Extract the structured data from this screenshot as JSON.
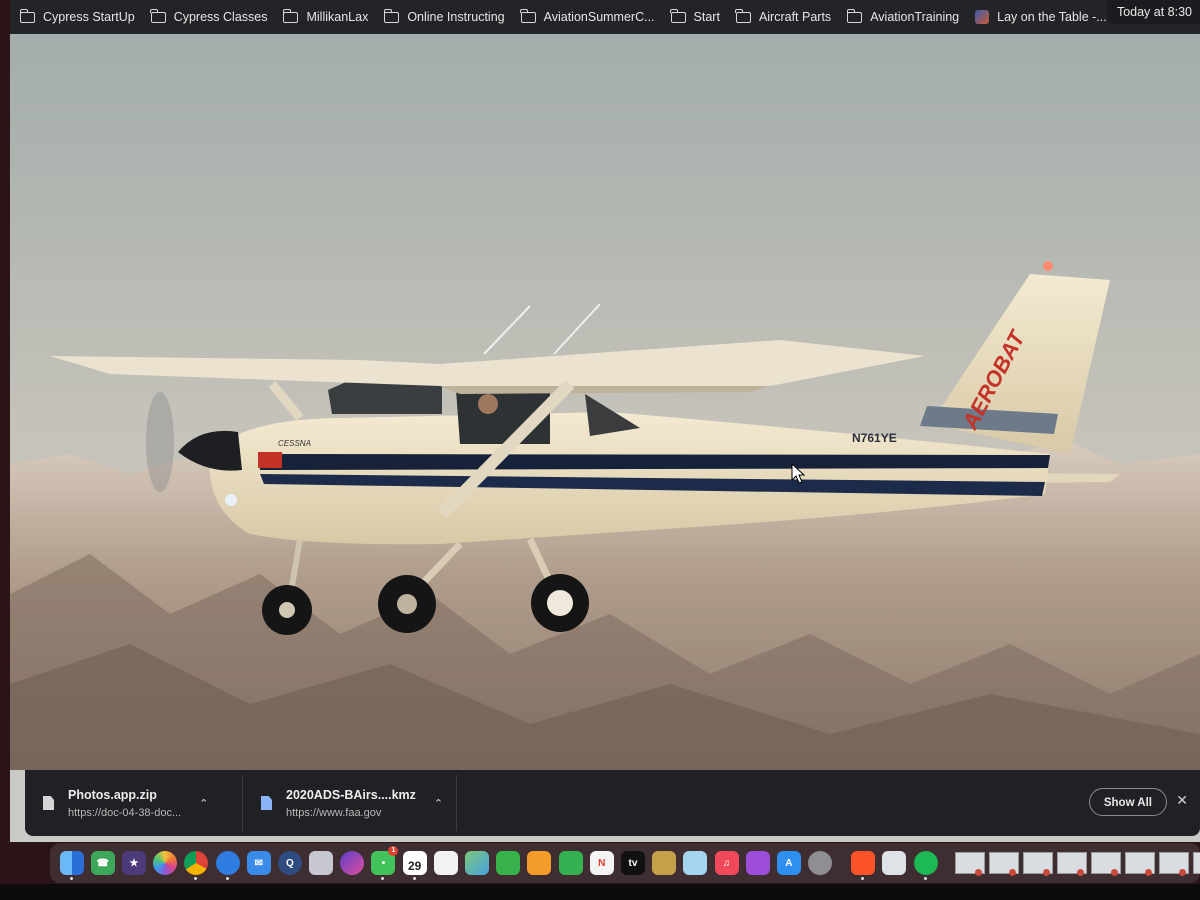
{
  "bookmarks": [
    {
      "label": "Cypress StartUp",
      "icon": "folder-icon"
    },
    {
      "label": "Cypress Classes",
      "icon": "folder-icon"
    },
    {
      "label": "MillikanLax",
      "icon": "folder-icon"
    },
    {
      "label": "Online Instructing",
      "icon": "folder-icon"
    },
    {
      "label": "AviationSummerC...",
      "icon": "folder-icon"
    },
    {
      "label": "Start",
      "icon": "folder-icon"
    },
    {
      "label": "Aircraft Parts",
      "icon": "folder-icon"
    },
    {
      "label": "AviationTraining",
      "icon": "folder-icon"
    },
    {
      "label": "Lay on the Table -...",
      "icon": "favicon"
    }
  ],
  "clock": {
    "text": "Today at 8:30"
  },
  "photo": {
    "fuselage_text": "CESSNA",
    "tail_text": "AEROBAT",
    "registration": "N761YE"
  },
  "downloads": {
    "items": [
      {
        "name": "Photos.app.zip",
        "url": "https://doc-04-38-doc...",
        "icon": "file-icon"
      },
      {
        "name": "2020ADS-BAirs....kmz",
        "url": "https://www.faa.gov",
        "icon": "file-icon"
      }
    ],
    "show_all_label": "Show All",
    "close_icon": "close-icon"
  },
  "dock": {
    "calendar_day": "29",
    "messages_badge": "1",
    "apple_tv_label": "tv",
    "icons": [
      "finder-icon",
      "facetime-icon",
      "imovie-icon",
      "photos-icon",
      "chrome-icon",
      "safari-icon",
      "mail-icon",
      "quicktime-icon",
      "launchpad-icon",
      "siri-icon",
      "messages-icon",
      "calendar-icon",
      "textedit-icon",
      "maps-icon",
      "facetime-video-icon",
      "pages-icon",
      "numbers-icon",
      "news-icon",
      "apple-tv-icon",
      "keynote-icon",
      "preview-icon",
      "music-icon",
      "podcasts-icon",
      "app-store-icon",
      "system-preferences-icon",
      "brave-icon",
      "finder-window-icon",
      "spotify-icon"
    ]
  }
}
